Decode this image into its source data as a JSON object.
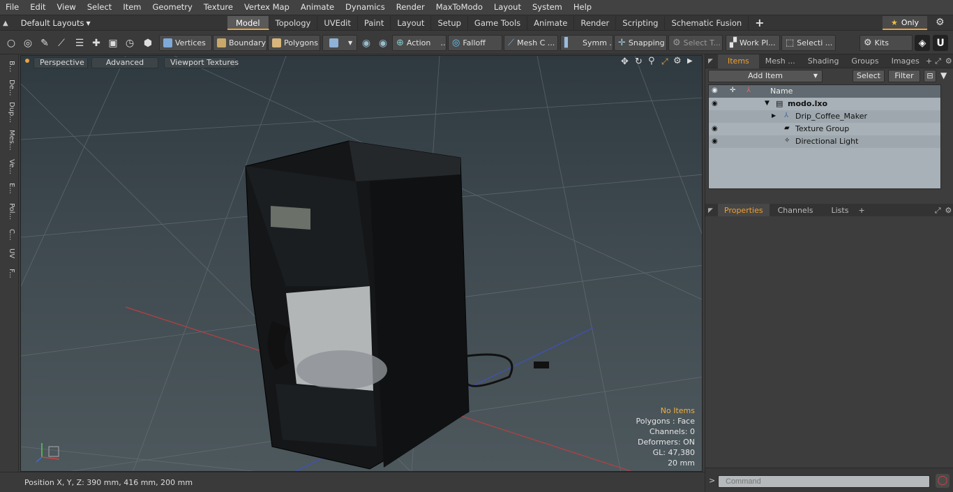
{
  "menubar": [
    "File",
    "Edit",
    "View",
    "Select",
    "Item",
    "Geometry",
    "Texture",
    "Vertex Map",
    "Animate",
    "Dynamics",
    "Render",
    "MaxToModo",
    "Layout",
    "System",
    "Help"
  ],
  "layoutbar": {
    "layout_label": "Default Layouts",
    "tabs": [
      "Model",
      "Topology",
      "UVEdit",
      "Paint",
      "Layout",
      "Setup",
      "Game Tools",
      "Animate",
      "Render",
      "Scripting",
      "Schematic Fusion"
    ],
    "active_tab": "Model",
    "add_tab": "+",
    "only_label": "Only"
  },
  "toolbar": {
    "vertices": "Vertices",
    "boundary": "Boundary",
    "polygons": "Polygons",
    "action": "Action",
    "falloff": "Falloff",
    "mesh_c": "Mesh C ...",
    "symm": "Symm ...",
    "snapping": "Snapping",
    "select_t": "Select T...",
    "work_pl": "Work Pl...",
    "selecti": "Selecti ...",
    "kits": "Kits"
  },
  "left_tabs": [
    "B...",
    "De...",
    "Dup...",
    "Mes...",
    "Ve...",
    "E...",
    "Pol...",
    "C...",
    "UV",
    "F..."
  ],
  "viewport": {
    "perspective": "Perspective",
    "advanced": "Advanced",
    "viewport_textures": "Viewport Textures",
    "stats": {
      "no_items": "No Items",
      "polygons": "Polygons : Face",
      "channels": "Channels: 0",
      "deformers": "Deformers: ON",
      "gl": "GL: 47,380",
      "scale": "20 mm"
    }
  },
  "status": {
    "position": "Position X, Y, Z:  390 mm, 416 mm, 200 mm"
  },
  "right_panel": {
    "top_tabs": [
      "Items",
      "Mesh ...",
      "Shading",
      "Groups",
      "Images"
    ],
    "active_top_tab": "Items",
    "add_item": "Add Item",
    "select": "Select",
    "filter": "Filter",
    "tree_header": "Name",
    "tree": [
      {
        "label": "modo.lxo",
        "bold": true
      },
      {
        "label": "Drip_Coffee_Maker",
        "bold": false
      },
      {
        "label": "Texture Group",
        "bold": false
      },
      {
        "label": "Directional Light",
        "bold": false
      }
    ],
    "bottom_tabs": [
      "Properties",
      "Channels",
      "Lists"
    ],
    "active_bottom_tab": "Properties",
    "command_placeholder": "Command",
    "cmd_prompt": ">"
  },
  "colors": {
    "accent": "#e8a33d",
    "active_tab_text": "#f0a030",
    "tree_bg": "#a7b1b7"
  }
}
